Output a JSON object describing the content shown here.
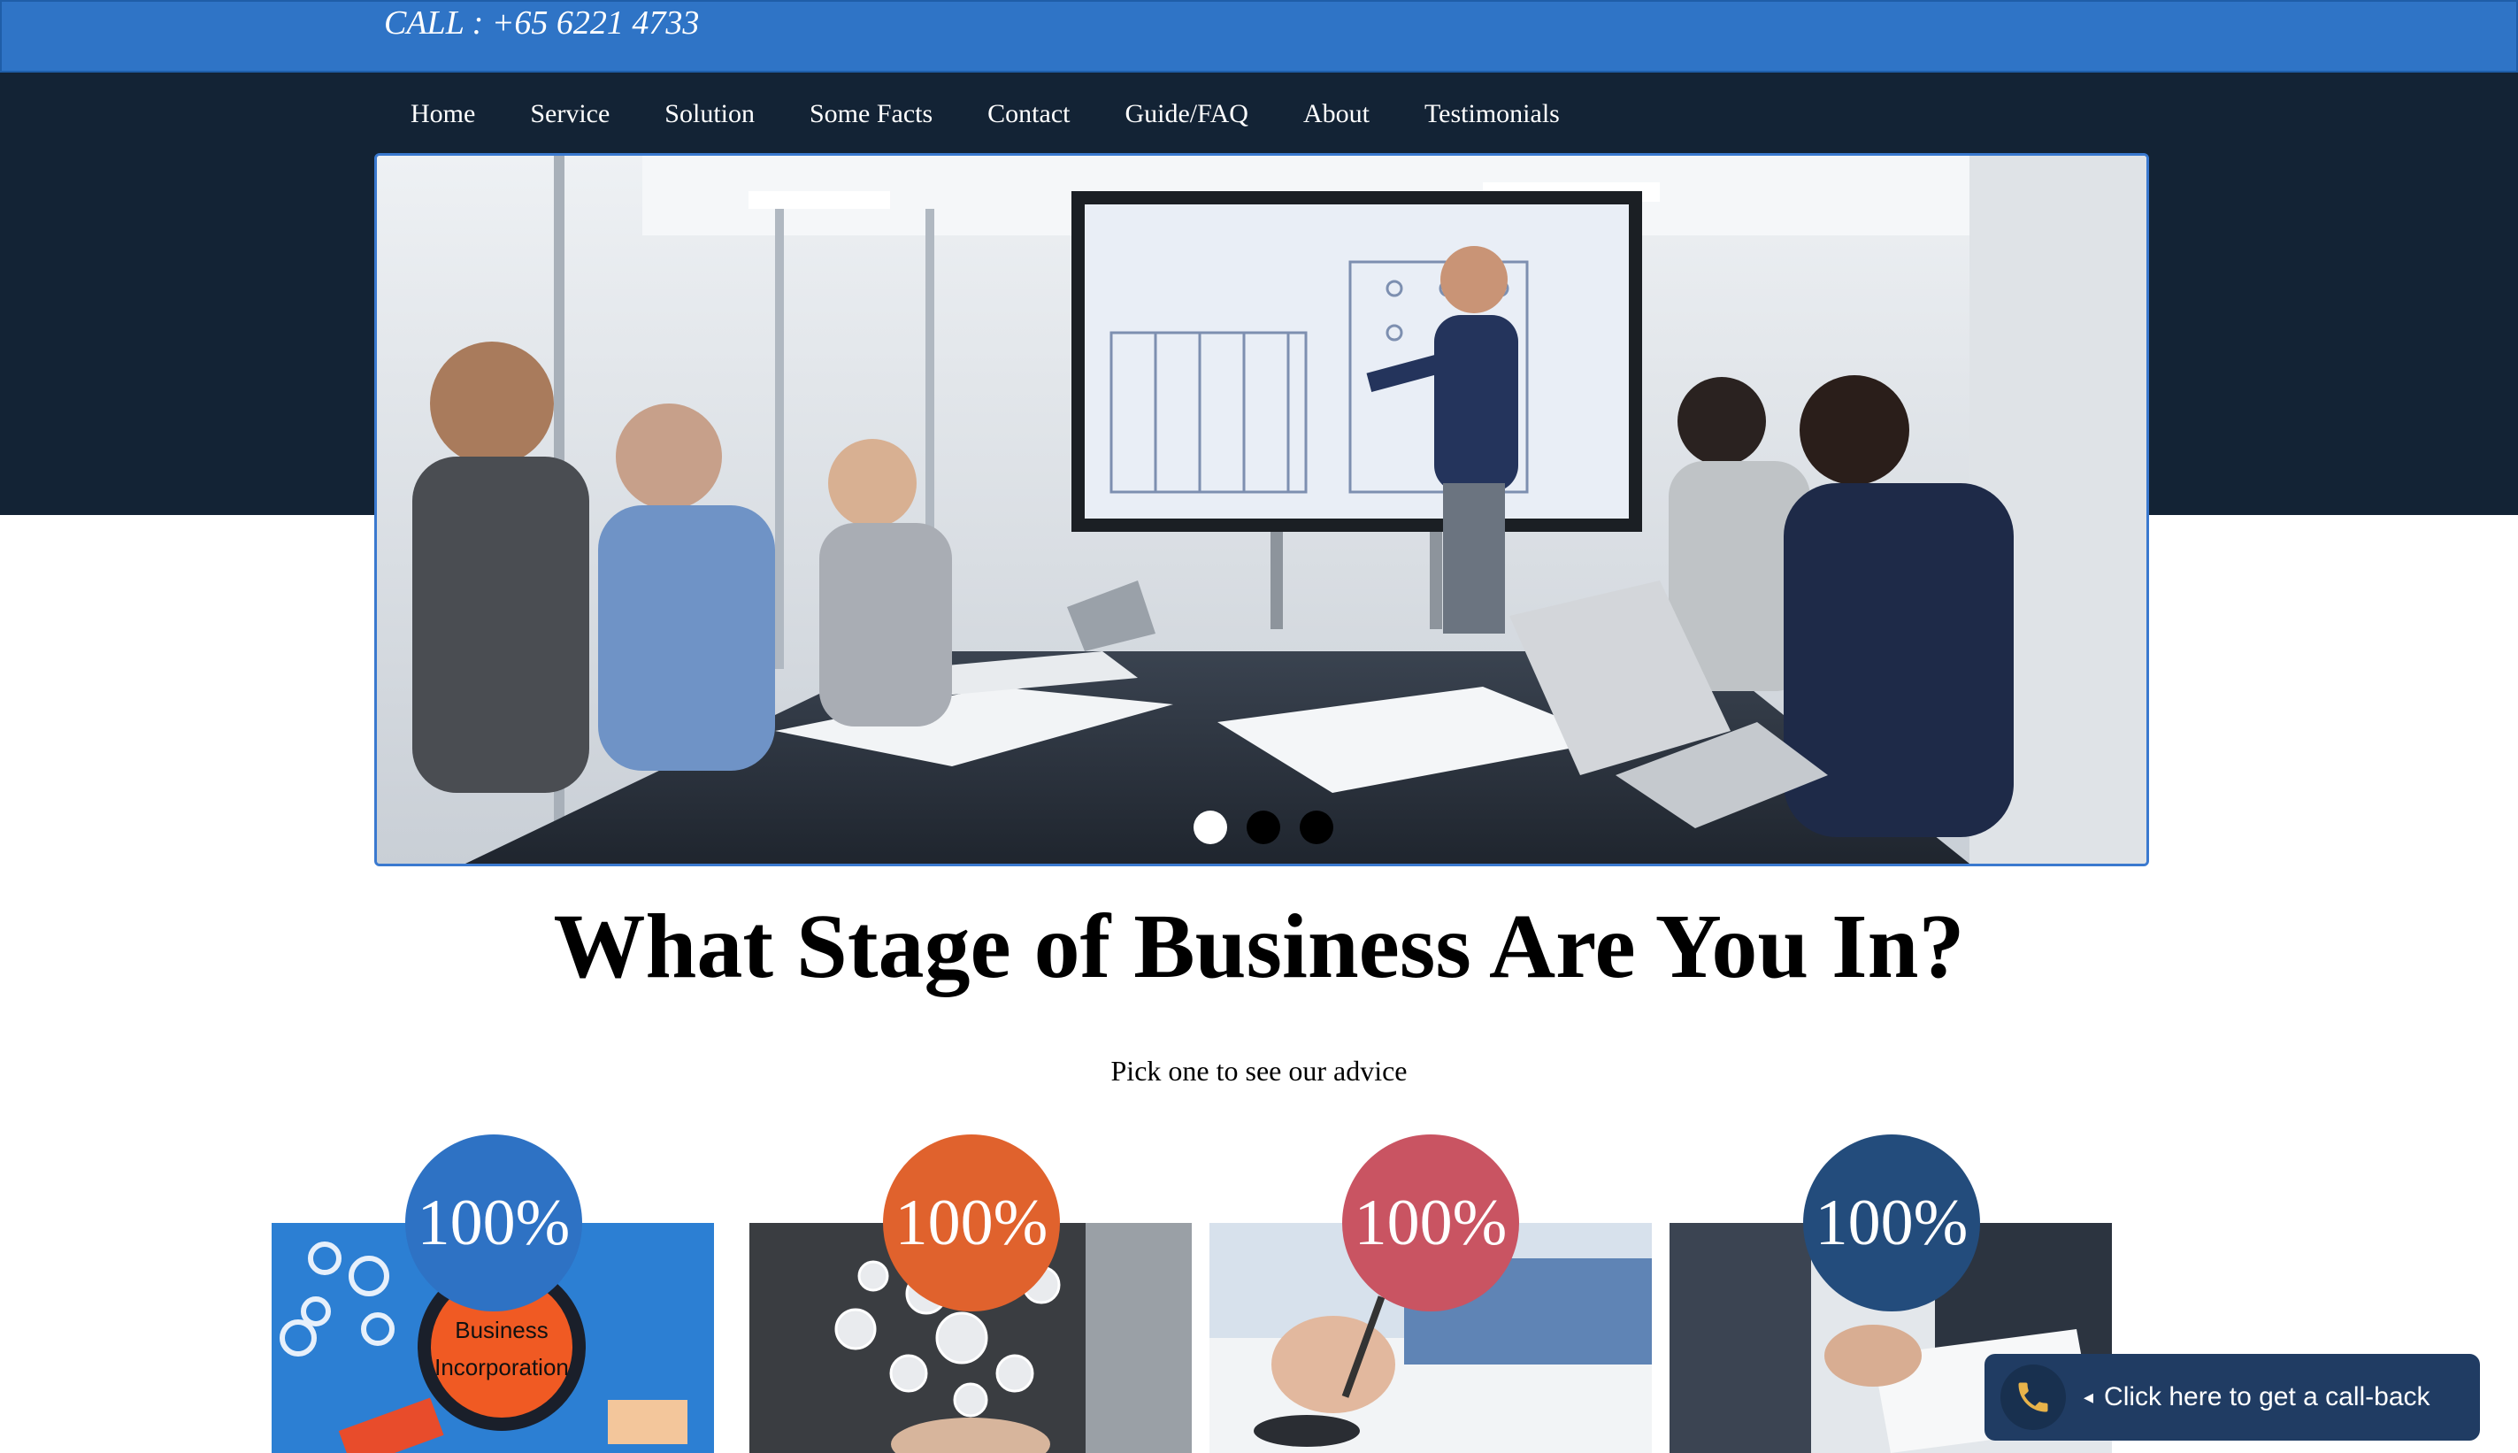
{
  "topbar": {
    "call_text": "CALL : +65 6221 4733"
  },
  "nav": {
    "items": [
      {
        "label": "Home"
      },
      {
        "label": "Service"
      },
      {
        "label": "Solution"
      },
      {
        "label": "Some Facts"
      },
      {
        "label": "Contact"
      },
      {
        "label": "Guide/FAQ"
      },
      {
        "label": "About"
      },
      {
        "label": "Testimonials"
      }
    ]
  },
  "hero": {
    "image": "business-meeting-presentation-photo",
    "slide_count": 3,
    "active_slide": 1
  },
  "stage": {
    "heading": "What Stage of Business Are You In?",
    "subheading": "Pick one to see our advice"
  },
  "cards": [
    {
      "badge": "100%",
      "badge_color": "#2e72c4",
      "image_text_line1": "Business",
      "image_text_line2": "Incorporation"
    },
    {
      "badge": "100%",
      "badge_color": "#e0622d"
    },
    {
      "badge": "100%",
      "badge_color": "#c95462"
    },
    {
      "badge": "100%",
      "badge_color": "#234c7c"
    }
  ],
  "callback": {
    "label": "Click here to get a call-back",
    "icon": "phone-icon"
  },
  "colors": {
    "topbar": "#2f74c6",
    "navband": "#132335",
    "callback_bg": "#203c63"
  }
}
